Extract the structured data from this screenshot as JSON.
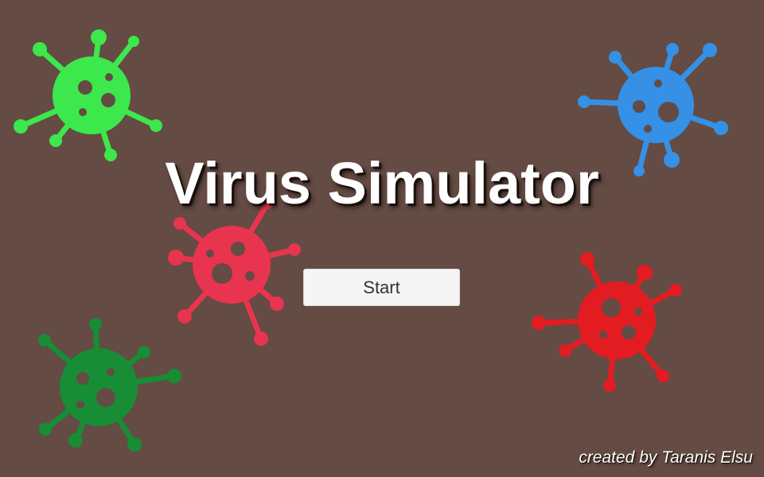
{
  "title": "Virus Simulator",
  "start_button_label": "Start",
  "credits": "created by Taranis Elsu",
  "colors": {
    "background": "#644b43",
    "text": "#ffffff",
    "button_background": "#f5f5f5",
    "button_text": "#333333",
    "virus_light_green": "#3ce84b",
    "virus_blue": "#3590e6",
    "virus_pink": "#e8344e",
    "virus_red": "#e31c22",
    "virus_dark_green": "#178d36"
  },
  "viruses": [
    {
      "name": "virus-light-green-icon",
      "color": "#3ce84b"
    },
    {
      "name": "virus-blue-icon",
      "color": "#3590e6"
    },
    {
      "name": "virus-pink-icon",
      "color": "#e8344e"
    },
    {
      "name": "virus-red-icon",
      "color": "#e31c22"
    },
    {
      "name": "virus-dark-green-icon",
      "color": "#178d36"
    }
  ]
}
